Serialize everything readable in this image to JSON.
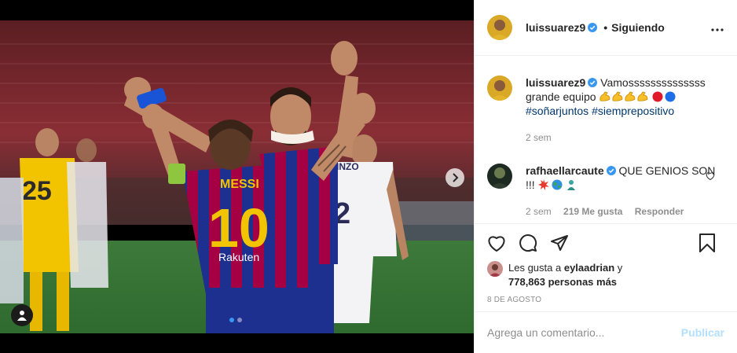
{
  "post": {
    "author": "luissuarez9",
    "follow_separator": "•",
    "follow_status": "Siguiendo",
    "more_icon": "ellipsis-icon"
  },
  "media": {
    "jersey_name": "MESSI",
    "jersey_number": "10",
    "sponsor": "Rakuten",
    "opponent_number": "2",
    "opponent_name": "INZO",
    "opponent_left_number": "25",
    "carousel": {
      "total": 2,
      "active": 1
    },
    "next_icon": "chevron-right-icon",
    "tag_icon": "user-tag-icon"
  },
  "caption": {
    "username": "luissuarez9",
    "text": "Vamossssssssssssss grande equipo",
    "emojis": [
      "flexed-biceps",
      "flexed-biceps",
      "flexed-biceps",
      "flexed-biceps",
      "red-circle",
      "blue-circle"
    ],
    "hashtags": [
      "#soñarjuntos",
      "#siemprepositivo"
    ],
    "age": "2 sem"
  },
  "comment": {
    "username": "rafhaellarcaute",
    "text": "QUE GENIOS SON !!!",
    "emojis": [
      "collision",
      "globe",
      "genie"
    ],
    "age": "2 sem",
    "likes": "219 Me gusta",
    "reply": "Responder"
  },
  "actions": {
    "like_icon": "heart-icon",
    "comment_icon": "comment-icon",
    "share_icon": "paper-plane-icon",
    "save_icon": "bookmark-icon"
  },
  "likes": {
    "prefix": "Les gusta a",
    "first_user": "eylaadrian",
    "joiner": "y",
    "others": "778,863 personas más"
  },
  "date": "8 DE AGOSTO",
  "composer": {
    "placeholder": "Agrega un comentario...",
    "publish": "Publicar"
  },
  "colors": {
    "link": "#00376b",
    "muted": "#8e8e8e",
    "verified": "#3897f0",
    "publish_disabled": "#b2dffc",
    "barca_blue": "#1d2f8f",
    "barca_red": "#a50044",
    "away_yellow": "#f2c400"
  }
}
